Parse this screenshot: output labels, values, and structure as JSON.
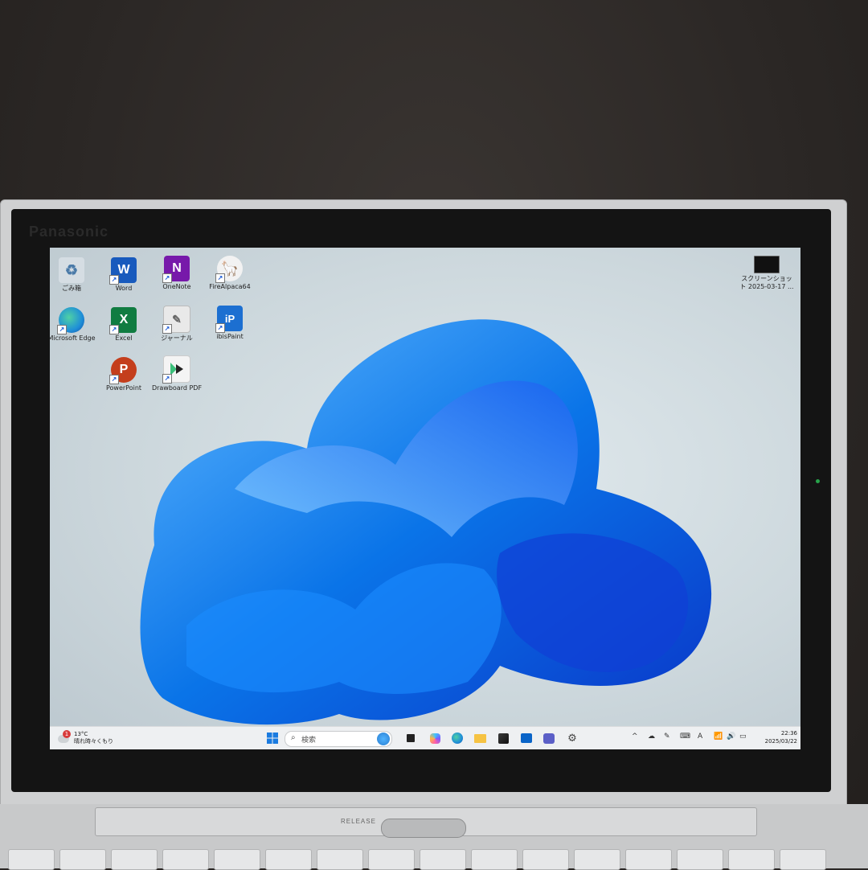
{
  "device": {
    "brand": "Panasonic",
    "release_label": "RELEASE"
  },
  "desktop": {
    "icons": [
      {
        "name": "recycle-bin-icon",
        "label": "ごみ箱",
        "color": "#d5dde3"
      },
      {
        "name": "word-icon",
        "label": "Word",
        "letter": "W",
        "color": "#185abd"
      },
      {
        "name": "onenote-icon",
        "label": "OneNote",
        "letter": "N",
        "color": "#7719aa"
      },
      {
        "name": "firealpaca-icon",
        "label": "FireAlpaca64",
        "color": "#f2f2f2"
      },
      {
        "name": "edge-icon",
        "label": "Microsoft Edge",
        "color": "#1f8fd8"
      },
      {
        "name": "excel-icon",
        "label": "Excel",
        "letter": "X",
        "color": "#107c41"
      },
      {
        "name": "journal-icon",
        "label": "ジャーナル",
        "color": "#e9e9e9"
      },
      {
        "name": "ibispaint-icon",
        "label": "ibisPaint",
        "letter": "iP",
        "color": "#1c6fd1"
      },
      {
        "name": "powerpoint-icon",
        "label": "PowerPoint",
        "letter": "P",
        "color": "#c43e1c"
      },
      {
        "name": "drawboard-icon",
        "label": "Drawboard PDF",
        "color": "#f4f4f4"
      },
      {
        "name": "screenshot-file-icon",
        "label": "スクリーンショット 2025-03-17 ...",
        "color": "#111111"
      }
    ]
  },
  "taskbar": {
    "weather": {
      "badge": "1",
      "temp": "13°C",
      "desc": "晴れ時々くもり"
    },
    "search_placeholder": "検索",
    "clock": {
      "time": "22:36",
      "date": "2025/03/22"
    },
    "tray_lang": "A"
  },
  "colors": {
    "accent": "#0a74e8",
    "taskbar": "#eef0f2"
  }
}
